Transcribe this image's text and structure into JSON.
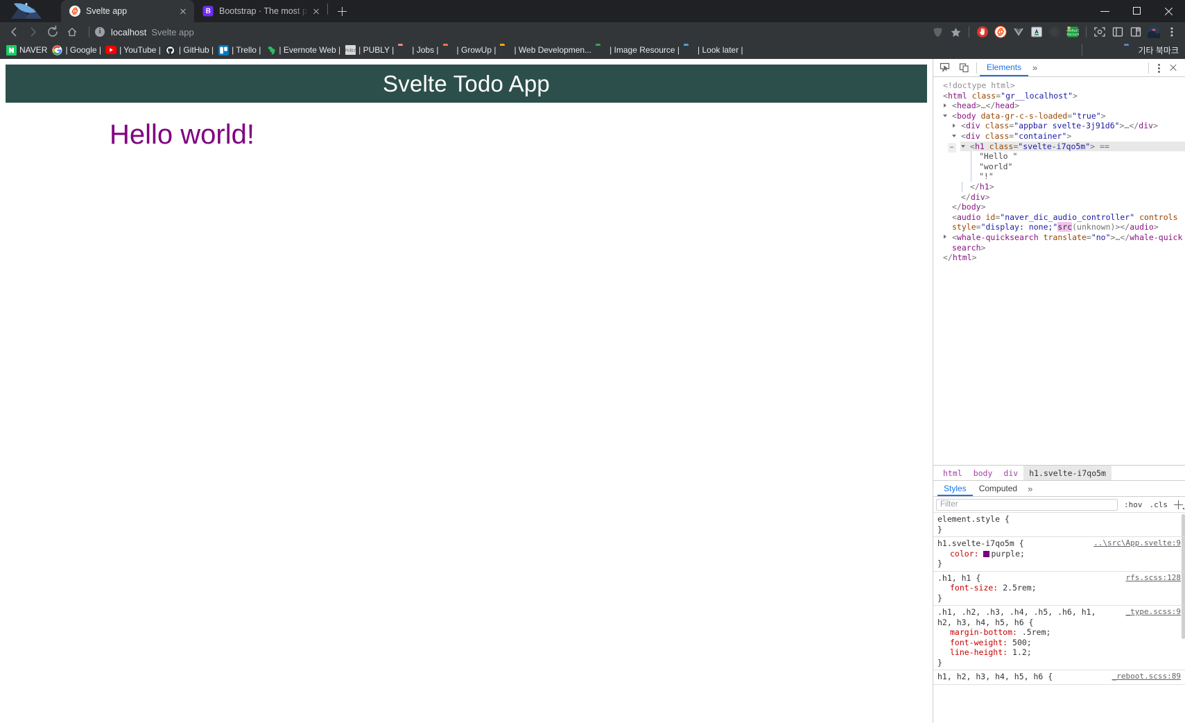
{
  "window": {
    "minimize_label": "Minimize",
    "maximize_label": "Maximize",
    "close_label": "Close"
  },
  "tabs": [
    {
      "title": "Svelte app",
      "favicon": "svelte-icon",
      "active": true,
      "close_label": "Close tab"
    },
    {
      "title": "Bootstrap · The most popular H",
      "favicon": "bootstrap-icon",
      "active": false,
      "close_label": "Close tab"
    }
  ],
  "new_tab_label": "New tab",
  "toolbar": {
    "back_label": "Back",
    "forward_label": "Forward",
    "reload_label": "Reload",
    "home_label": "Home",
    "url": "localhost",
    "page_title": "Svelte app",
    "info_glyph": "i",
    "extensions": [
      {
        "name": "whale-shield-icon",
        "color": "#5f6368"
      },
      {
        "name": "bookmark-star-icon",
        "color": "#9aa0a6"
      },
      {
        "name": "adblock-icon",
        "color": "#d9372a"
      },
      {
        "name": "svelte-extension-icon",
        "color": "#ff3e00"
      },
      {
        "name": "vuejs-devtools-icon",
        "color": "#9aa0a6"
      },
      {
        "name": "papago-translate-icon",
        "color": "#2b5c8a"
      },
      {
        "name": "react-devtools-icon",
        "color": "#61dafb"
      },
      {
        "name": "naver-dictionary-icon",
        "color": "#19ce60"
      }
    ],
    "right_icons": [
      {
        "name": "capture-icon"
      },
      {
        "name": "sidebar-panel-icon"
      },
      {
        "name": "split-view-icon"
      },
      {
        "name": "profile-avatar"
      },
      {
        "name": "browser-menu-icon"
      }
    ]
  },
  "bookmarks": [
    {
      "label": "NAVER",
      "icon": "naver-favicon",
      "icon_color": "#19ce60"
    },
    {
      "label": "| Google |",
      "icon": "google-favicon",
      "icon_color": "#4285f4"
    },
    {
      "label": "| YouTube |",
      "icon": "youtube-favicon",
      "icon_color": "#ff0000"
    },
    {
      "label": "| GitHub |",
      "icon": "github-favicon",
      "icon_color": "#24292e"
    },
    {
      "label": "| Trello |",
      "icon": "trello-favicon",
      "icon_color": "#0079bf"
    },
    {
      "label": "| Evernote Web |",
      "icon": "evernote-favicon",
      "icon_color": "#2dbe60"
    },
    {
      "label": "| PUBLY |",
      "icon": "publy-favicon",
      "icon_color": "#888888"
    },
    {
      "label": "| Jobs |",
      "icon": "folder-icon",
      "icon_color": "#f28b82"
    },
    {
      "label": "| GrowUp |",
      "icon": "folder-icon",
      "icon_color": "#ee7752"
    },
    {
      "label": "| Web Developmen...",
      "icon": "folder-icon",
      "icon_color": "#f9ab00"
    },
    {
      "label": "| Image Resource |",
      "icon": "folder-icon",
      "icon_color": "#34a853"
    },
    {
      "label": "| Look later |",
      "icon": "folder-icon",
      "icon_color": "#4da3d8"
    }
  ],
  "other_bookmarks": {
    "label": "기타 북마크",
    "icon": "folder-icon",
    "icon_color": "#5b84c4"
  },
  "page": {
    "appbar_title": "Svelte Todo App",
    "appbar_bg": "#2d4f4b",
    "heading": "Hello world!",
    "heading_color": "purple"
  },
  "devtools": {
    "header": {
      "inspect_label": "Inspect element",
      "device_toolbar_label": "Toggle device toolbar",
      "tabs": [
        {
          "label": "Elements",
          "selected": true
        }
      ],
      "overflow_label": "»",
      "more_label": "More options",
      "close_label": "Close DevTools"
    },
    "dom_lines": [
      {
        "indent": 0,
        "twist": "none",
        "segments": [
          {
            "cls": "cm",
            "t": "<!doctype html>"
          }
        ]
      },
      {
        "indent": 0,
        "twist": "none",
        "segments": [
          {
            "cls": "pk",
            "t": "<"
          },
          {
            "cls": "tg",
            "t": "html"
          },
          {
            "cls": "pk",
            "t": " "
          },
          {
            "cls": "an",
            "t": "class"
          },
          {
            "cls": "pk",
            "t": "="
          },
          {
            "cls": "av",
            "t": "\"gr__localhost\""
          },
          {
            "cls": "pk",
            "t": ">"
          }
        ]
      },
      {
        "indent": 1,
        "twist": "closed",
        "segments": [
          {
            "cls": "pk",
            "t": "<"
          },
          {
            "cls": "tg",
            "t": "head"
          },
          {
            "cls": "pk",
            "t": ">"
          },
          {
            "cls": "pk",
            "t": "…"
          },
          {
            "cls": "pk",
            "t": "</"
          },
          {
            "cls": "tg",
            "t": "head"
          },
          {
            "cls": "pk",
            "t": ">"
          }
        ]
      },
      {
        "indent": 1,
        "twist": "open",
        "segments": [
          {
            "cls": "pk",
            "t": "<"
          },
          {
            "cls": "tg",
            "t": "body"
          },
          {
            "cls": "pk",
            "t": " "
          },
          {
            "cls": "an",
            "t": "data-gr-c-s-loaded"
          },
          {
            "cls": "pk",
            "t": "="
          },
          {
            "cls": "av",
            "t": "\"true\""
          },
          {
            "cls": "pk",
            "t": ">"
          }
        ]
      },
      {
        "indent": 2,
        "twist": "closed",
        "segments": [
          {
            "cls": "pk",
            "t": "<"
          },
          {
            "cls": "tg",
            "t": "div"
          },
          {
            "cls": "pk",
            "t": " "
          },
          {
            "cls": "an",
            "t": "class"
          },
          {
            "cls": "pk",
            "t": "="
          },
          {
            "cls": "av",
            "t": "\"appbar svelte-3j91d6\""
          },
          {
            "cls": "pk",
            "t": ">"
          },
          {
            "cls": "pk",
            "t": "…"
          },
          {
            "cls": "pk",
            "t": "</"
          },
          {
            "cls": "tg",
            "t": "div"
          },
          {
            "cls": "pk",
            "t": ">"
          }
        ]
      },
      {
        "indent": 2,
        "twist": "open",
        "segments": [
          {
            "cls": "pk",
            "t": "<"
          },
          {
            "cls": "tg",
            "t": "div"
          },
          {
            "cls": "pk",
            "t": " "
          },
          {
            "cls": "an",
            "t": "class"
          },
          {
            "cls": "pk",
            "t": "="
          },
          {
            "cls": "av",
            "t": "\"container\""
          },
          {
            "cls": "pk",
            "t": ">"
          }
        ]
      },
      {
        "indent": 3,
        "twist": "open",
        "selected": true,
        "ellipsis": "…",
        "segments": [
          {
            "cls": "pk",
            "t": "<"
          },
          {
            "cls": "tg",
            "t": "h1"
          },
          {
            "cls": "pk",
            "t": " "
          },
          {
            "cls": "an",
            "t": "class"
          },
          {
            "cls": "pk",
            "t": "="
          },
          {
            "cls": "av",
            "t": "\"svelte-i7qo5m\""
          },
          {
            "cls": "pk",
            "t": "> "
          },
          {
            "cls": "pk",
            "t": "=="
          }
        ]
      },
      {
        "indent": 4,
        "twist": "none",
        "guide": true,
        "segments": [
          {
            "cls": "tx",
            "t": "\"Hello \""
          }
        ]
      },
      {
        "indent": 4,
        "twist": "none",
        "guide": true,
        "segments": [
          {
            "cls": "tx",
            "t": "\"world\""
          }
        ]
      },
      {
        "indent": 4,
        "twist": "none",
        "guide": true,
        "segments": [
          {
            "cls": "tx",
            "t": "\"!\""
          }
        ]
      },
      {
        "indent": 3,
        "twist": "none",
        "guide": true,
        "segments": [
          {
            "cls": "pk",
            "t": "</"
          },
          {
            "cls": "tg",
            "t": "h1"
          },
          {
            "cls": "pk",
            "t": ">"
          }
        ]
      },
      {
        "indent": 2,
        "twist": "none",
        "segments": [
          {
            "cls": "pk",
            "t": "</"
          },
          {
            "cls": "tg",
            "t": "div"
          },
          {
            "cls": "pk",
            "t": ">"
          }
        ]
      },
      {
        "indent": 1,
        "twist": "none",
        "segments": [
          {
            "cls": "pk",
            "t": "</"
          },
          {
            "cls": "tg",
            "t": "body"
          },
          {
            "cls": "pk",
            "t": ">"
          }
        ]
      },
      {
        "indent": 1,
        "twist": "none",
        "segments": [
          {
            "cls": "pk",
            "t": "<"
          },
          {
            "cls": "tg",
            "t": "audio"
          },
          {
            "cls": "pk",
            "t": " "
          },
          {
            "cls": "an",
            "t": "id"
          },
          {
            "cls": "pk",
            "t": "="
          },
          {
            "cls": "av",
            "t": "\"naver_dic_audio_controller\""
          },
          {
            "cls": "pk",
            "t": " "
          },
          {
            "cls": "an",
            "t": "controls"
          },
          {
            "cls": "pk",
            "t": " "
          },
          {
            "cls": "an",
            "t": "style"
          },
          {
            "cls": "pk",
            "t": "="
          },
          {
            "cls": "av",
            "t": "\"display: none;\""
          },
          {
            "cls": "hl",
            "t": "src"
          },
          {
            "cls": "pk",
            "t": "(unknown)>"
          },
          {
            "cls": "pk",
            "t": "</"
          },
          {
            "cls": "tg",
            "t": "audio"
          },
          {
            "cls": "pk",
            "t": ">"
          }
        ]
      },
      {
        "indent": 1,
        "twist": "closed",
        "segments": [
          {
            "cls": "pk",
            "t": "<"
          },
          {
            "cls": "tg",
            "t": "whale-quicksearch"
          },
          {
            "cls": "pk",
            "t": " "
          },
          {
            "cls": "an",
            "t": "translate"
          },
          {
            "cls": "pk",
            "t": "="
          },
          {
            "cls": "av",
            "t": "\"no\""
          },
          {
            "cls": "pk",
            "t": ">…</"
          },
          {
            "cls": "tg",
            "t": "whale-quicksearch"
          },
          {
            "cls": "pk",
            "t": ">"
          }
        ]
      },
      {
        "indent": 0,
        "twist": "none",
        "segments": [
          {
            "cls": "pk",
            "t": "</"
          },
          {
            "cls": "tg",
            "t": "html"
          },
          {
            "cls": "pk",
            "t": ">"
          }
        ]
      }
    ],
    "breadcrumbs": [
      {
        "label": "html",
        "selected": false
      },
      {
        "label": "body",
        "selected": false
      },
      {
        "label": "div",
        "selected": false
      },
      {
        "label": "h1.svelte-i7qo5m",
        "selected": true
      }
    ],
    "styles_pane": {
      "tabs": [
        {
          "label": "Styles",
          "selected": true
        },
        {
          "label": "Computed",
          "selected": false
        }
      ],
      "overflow_label": "»",
      "filter_placeholder": "Filter",
      "hov_label": ":hov",
      "cls_label": ".cls",
      "new_rule_label": "New style rule",
      "rules": [
        {
          "selector": "element.style {",
          "closer": "}",
          "source": "",
          "declarations": []
        },
        {
          "selector": "h1.svelte-i7qo5m {",
          "closer": "}",
          "source": "..\\src\\App.svelte:9",
          "declarations": [
            {
              "prop": "color",
              "value": "purple",
              "swatch": "purple"
            }
          ]
        },
        {
          "selector": ".h1, h1 {",
          "closer": "}",
          "source": "rfs.scss:128",
          "declarations": [
            {
              "prop": "font-size",
              "value": "2.5rem"
            }
          ]
        },
        {
          "selector": ".h1, .h2, .h3, .h4, .h5, .h6, h1, h2, h3, h4, h5, h6 {",
          "closer": "}",
          "source": "_type.scss:9",
          "declarations": [
            {
              "prop": "margin-bottom",
              "value": ".5rem"
            },
            {
              "prop": "font-weight",
              "value": "500"
            },
            {
              "prop": "line-height",
              "value": "1.2"
            }
          ]
        },
        {
          "selector": "h1, h2, h3, h4, h5, h6 {",
          "closer": "",
          "source": "_reboot.scss:89",
          "declarations": []
        }
      ]
    }
  }
}
